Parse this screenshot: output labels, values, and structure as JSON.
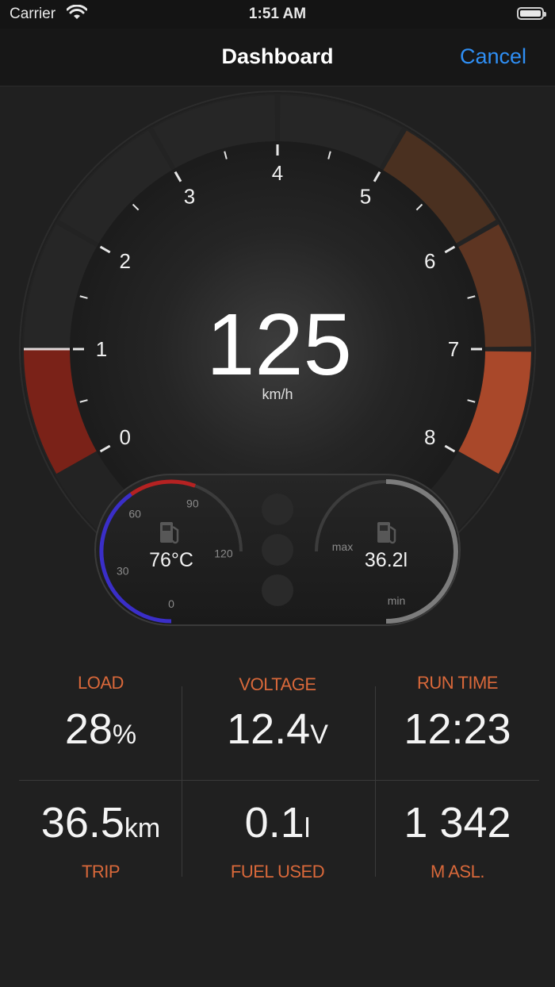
{
  "status_bar": {
    "carrier": "Carrier",
    "time": "1:51 AM"
  },
  "nav": {
    "title": "Dashboard",
    "cancel_label": "Cancel"
  },
  "speedometer": {
    "speed": "125",
    "unit": "km/h",
    "scale_labels": [
      "0",
      "1",
      "2",
      "3",
      "4",
      "5",
      "6",
      "7",
      "8"
    ],
    "speed_fraction": 0.125,
    "zone_colors": {
      "low": "#7a2218",
      "mid_dark": "#4a3020",
      "mid": "#5e3522",
      "high": "#a9482a"
    }
  },
  "temperature_gauge": {
    "value": "76°C",
    "scale_labels": [
      "0",
      "30",
      "60",
      "90",
      "120"
    ],
    "icon": "fuel-pump-icon"
  },
  "fuel_gauge": {
    "value": "36.2l",
    "max_label": "max",
    "min_label": "min",
    "icon": "fuel-pump-icon"
  },
  "stats": {
    "load": {
      "label": "LOAD",
      "value": "28",
      "unit": "%"
    },
    "voltage": {
      "label": "VOLTAGE",
      "value": "12.4",
      "unit": "V"
    },
    "run_time": {
      "label": "RUN TIME",
      "value": "12:23",
      "unit": ""
    },
    "trip": {
      "label": "TRIP",
      "value": "36.5",
      "unit": "km"
    },
    "fuel_used": {
      "label": "FUEL USED",
      "value": "0.1",
      "unit": "l"
    },
    "altitude": {
      "label": "M ASL.",
      "value": "1 342",
      "unit": ""
    }
  }
}
